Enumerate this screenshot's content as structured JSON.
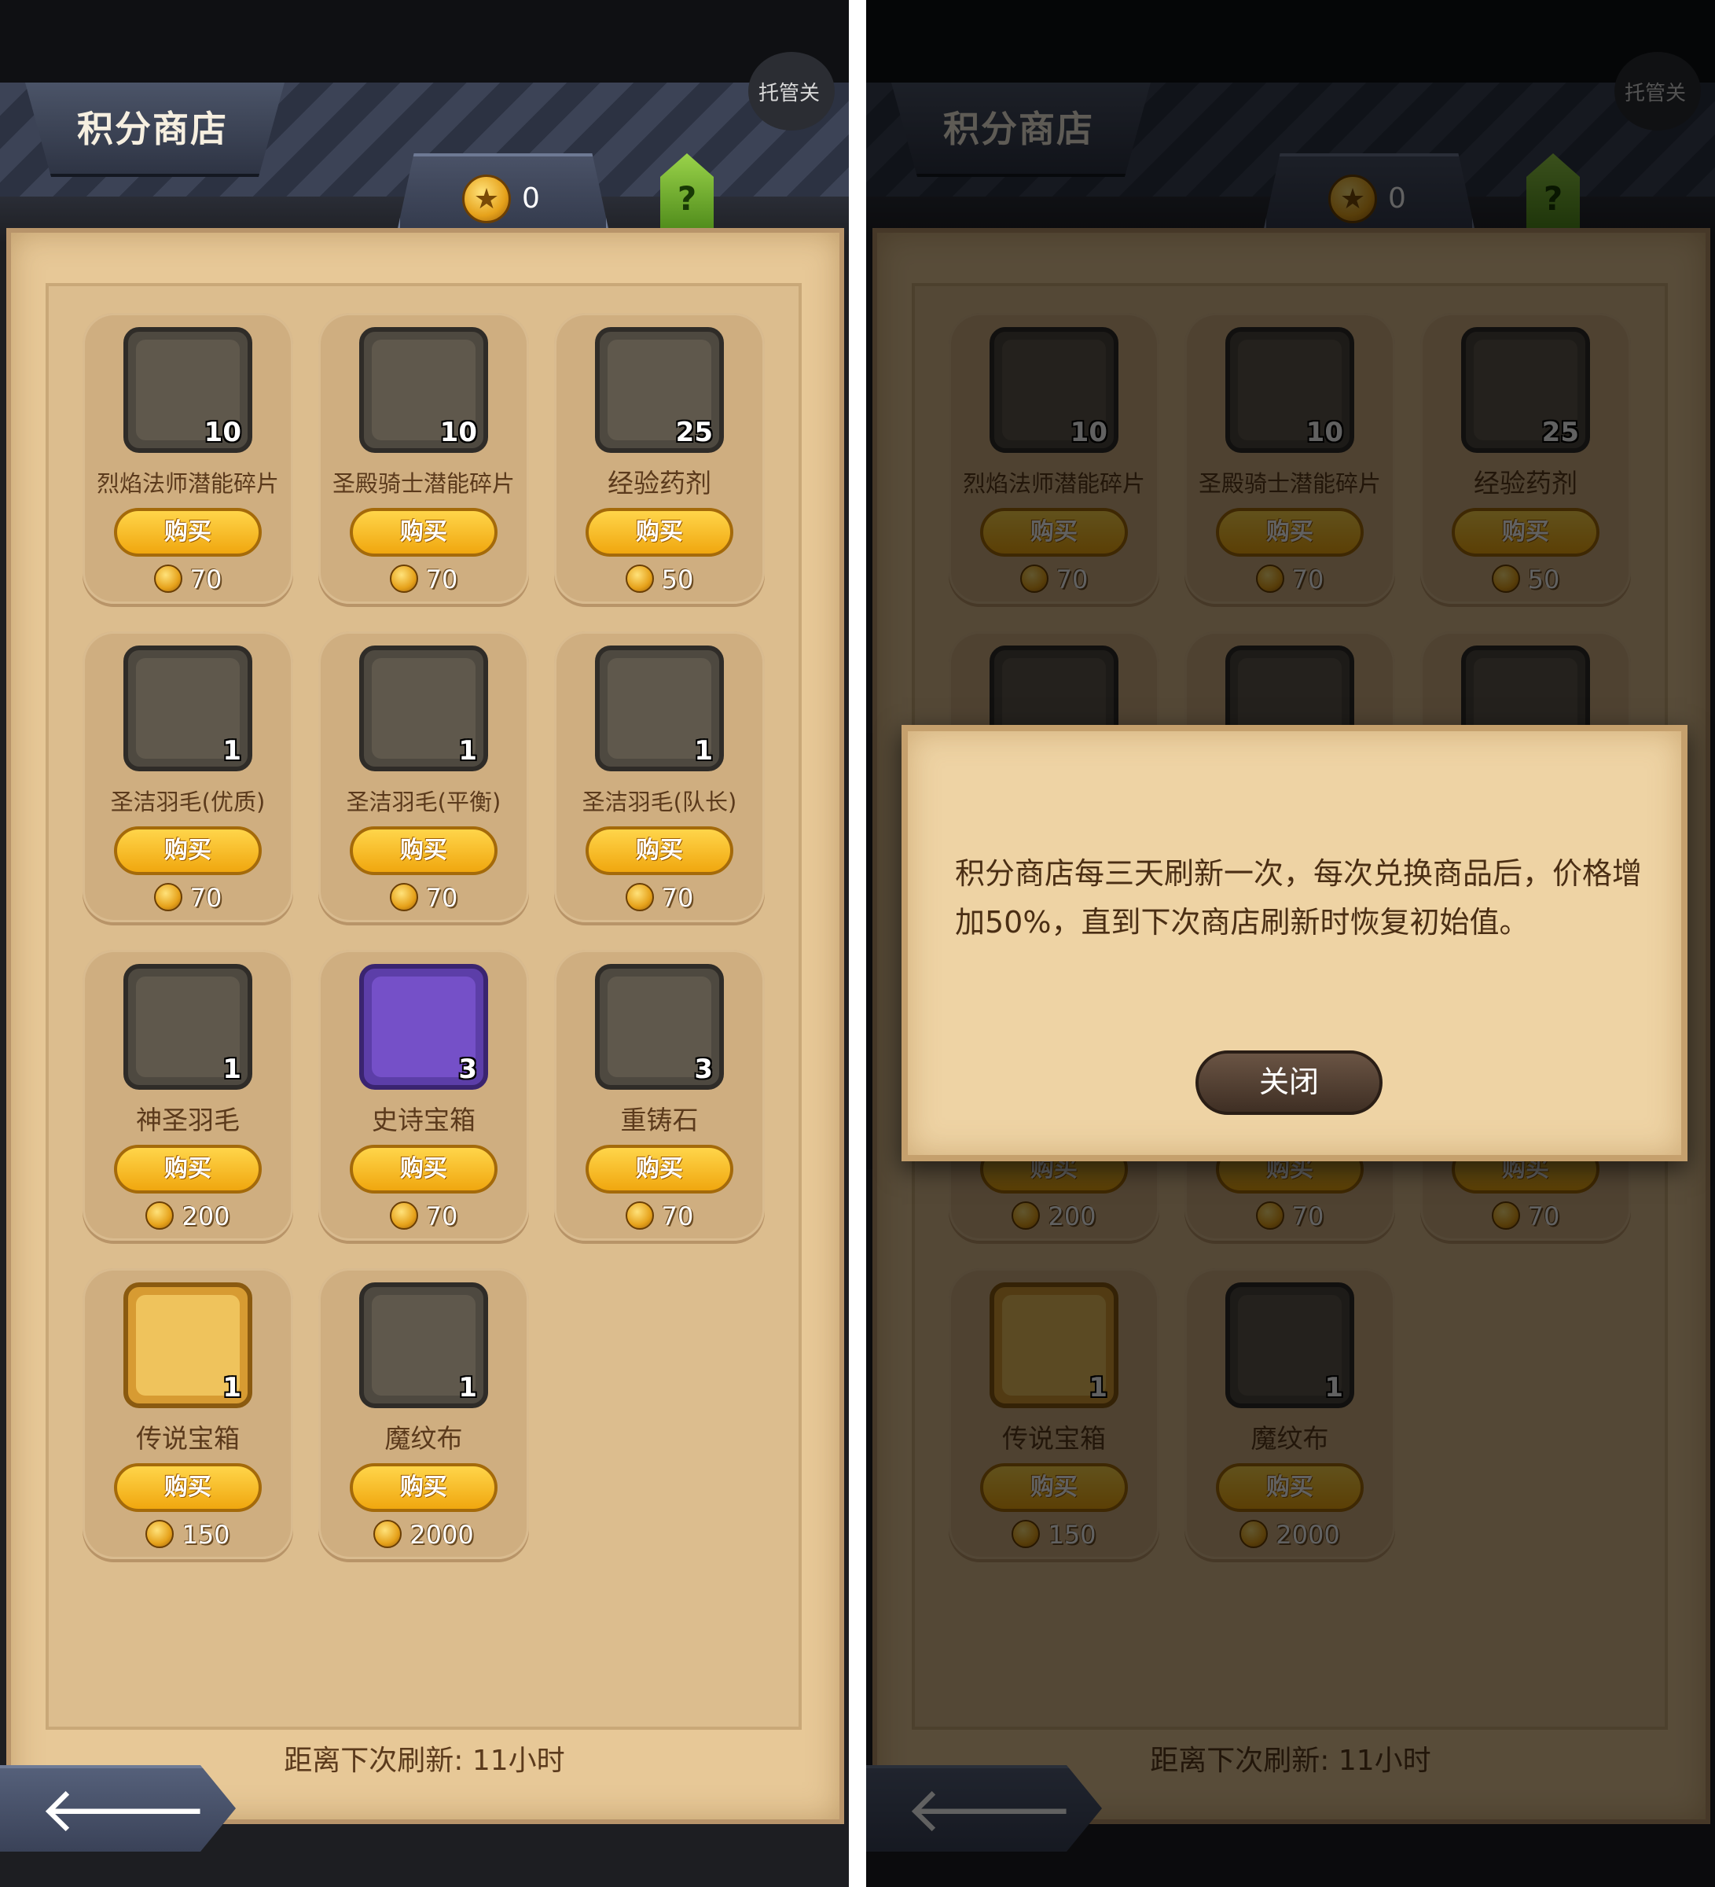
{
  "header": {
    "title": "积分商店",
    "auto_label": "托管关",
    "points": "0",
    "help_label": "?"
  },
  "items": [
    {
      "name": "烈焰法师潜能碎片",
      "qty": "10",
      "buy": "购买",
      "price": "70",
      "icon": "fire-mage-portrait-icon",
      "frame": "normal"
    },
    {
      "name": "圣殿骑士潜能碎片",
      "qty": "10",
      "buy": "购买",
      "price": "70",
      "icon": "templar-knight-portrait-icon",
      "frame": "normal"
    },
    {
      "name": "经验药剂",
      "qty": "25",
      "buy": "购买",
      "price": "50",
      "icon": "exp-potion-icon",
      "frame": "normal"
    },
    {
      "name": "圣洁羽毛(优质)",
      "qty": "1",
      "buy": "购买",
      "price": "70",
      "icon": "green-feather-icon",
      "frame": "normal"
    },
    {
      "name": "圣洁羽毛(平衡)",
      "qty": "1",
      "buy": "购买",
      "price": "70",
      "icon": "blue-feather-icon",
      "frame": "normal"
    },
    {
      "name": "圣洁羽毛(队长)",
      "qty": "1",
      "buy": "购买",
      "price": "70",
      "icon": "purple-feather-icon",
      "frame": "normal"
    },
    {
      "name": "神圣羽毛",
      "qty": "1",
      "buy": "购买",
      "price": "200",
      "icon": "golden-feather-icon",
      "frame": "normal"
    },
    {
      "name": "史诗宝箱",
      "qty": "3",
      "buy": "购买",
      "price": "70",
      "icon": "epic-chest-icon",
      "frame": "epic"
    },
    {
      "name": "重铸石",
      "qty": "3",
      "buy": "购买",
      "price": "70",
      "icon": "reforge-stone-icon",
      "frame": "normal"
    },
    {
      "name": "传说宝箱",
      "qty": "1",
      "buy": "购买",
      "price": "150",
      "icon": "legend-chest-icon",
      "frame": "legend"
    },
    {
      "name": "魔纹布",
      "qty": "1",
      "buy": "购买",
      "price": "2000",
      "icon": "magic-cloth-icon",
      "frame": "normal"
    }
  ],
  "footer": {
    "refresh_text": "距离下次刷新: 11小时"
  },
  "modal": {
    "message": "积分商店每三天刷新一次，每次兑换商品后，价格增加50%，直到下次商店刷新时恢复初始值。",
    "close_label": "关闭"
  },
  "colors": {
    "parchment": "#e7c897",
    "card": "#cfae80",
    "buy_button": "#f0a70f",
    "header": "#3c4356"
  }
}
